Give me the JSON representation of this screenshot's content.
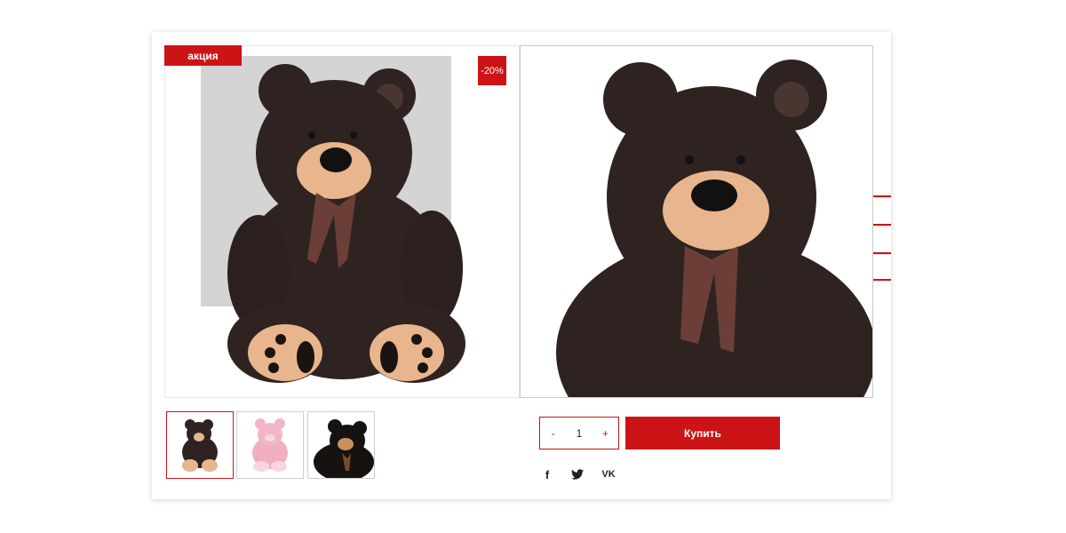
{
  "product": {
    "sale_badge": "акция",
    "discount_badge": "-20%",
    "quantity": {
      "minus": "-",
      "value": "1",
      "plus": "+"
    },
    "buy_label": "Купить",
    "thumbnails": [
      {
        "name": "dark-brown-bear",
        "selected": true
      },
      {
        "name": "pink-bear",
        "selected": false
      },
      {
        "name": "black-bear",
        "selected": false
      }
    ]
  },
  "share": {
    "icons": [
      "facebook-icon",
      "twitter-icon",
      "vk-icon"
    ],
    "facebook_glyph": "f",
    "vk_glyph": "VK"
  },
  "colors": {
    "accent": "#cc1316",
    "bear_fur": "#2e2320",
    "muzzle": "#e8b58c",
    "lens": "#d4d4d4"
  }
}
